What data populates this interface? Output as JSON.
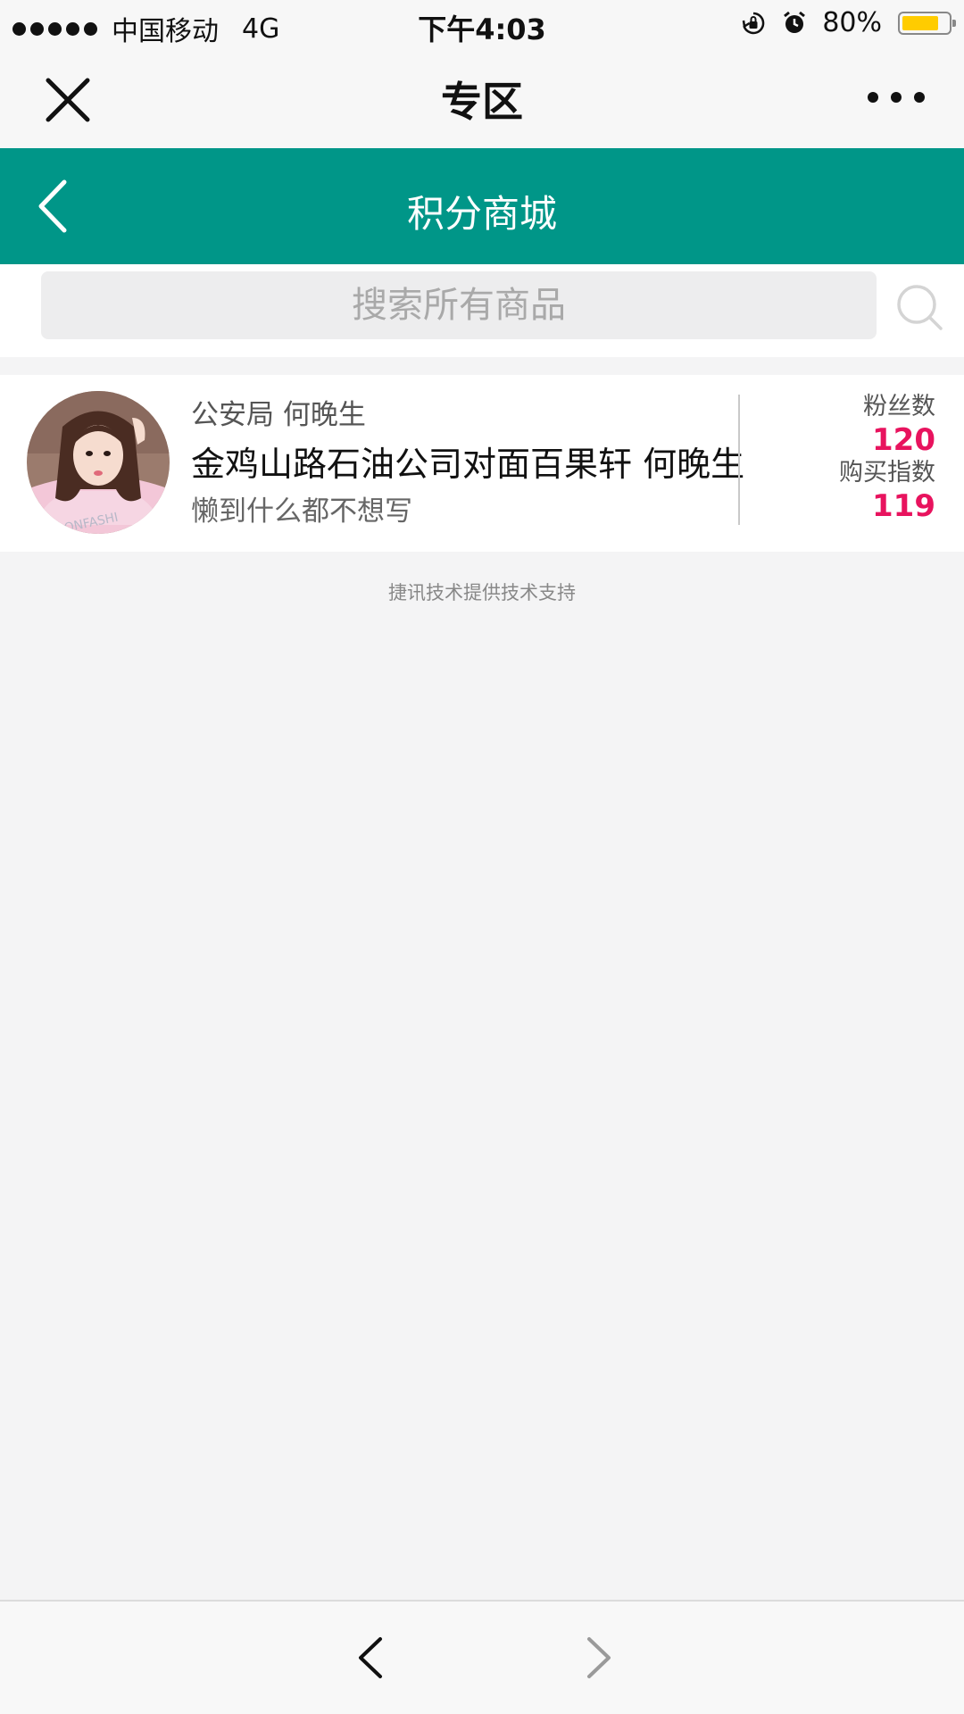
{
  "status_bar": {
    "carrier": "中国移动",
    "network": "4G",
    "time": "下午4:03",
    "battery_percent": "80%",
    "battery_level": 0.8,
    "battery_color": "#ffcc00"
  },
  "top_nav": {
    "title": "专区",
    "close_icon": "close-icon",
    "more_icon": "more-icon"
  },
  "header": {
    "title": "积分商城",
    "background_color": "#009688",
    "back_icon": "chevron-left-icon"
  },
  "search": {
    "placeholder": "搜索所有商品",
    "icon": "search-icon"
  },
  "profile": {
    "org_and_name": "公安局 何晚生",
    "address": "金鸡山路石油公司对面百果轩 何晚生",
    "motto": "懒到什么都不想写",
    "fans_label": "粉丝数",
    "fans_count": "120",
    "purchase_index_label": "购买指数",
    "purchase_index": "119",
    "accent_color": "#e8135e"
  },
  "footer": {
    "credit": "捷讯技术提供技术支持"
  },
  "bottom_nav": {
    "back_icon": "chevron-left-icon",
    "forward_icon": "chevron-right-icon"
  }
}
